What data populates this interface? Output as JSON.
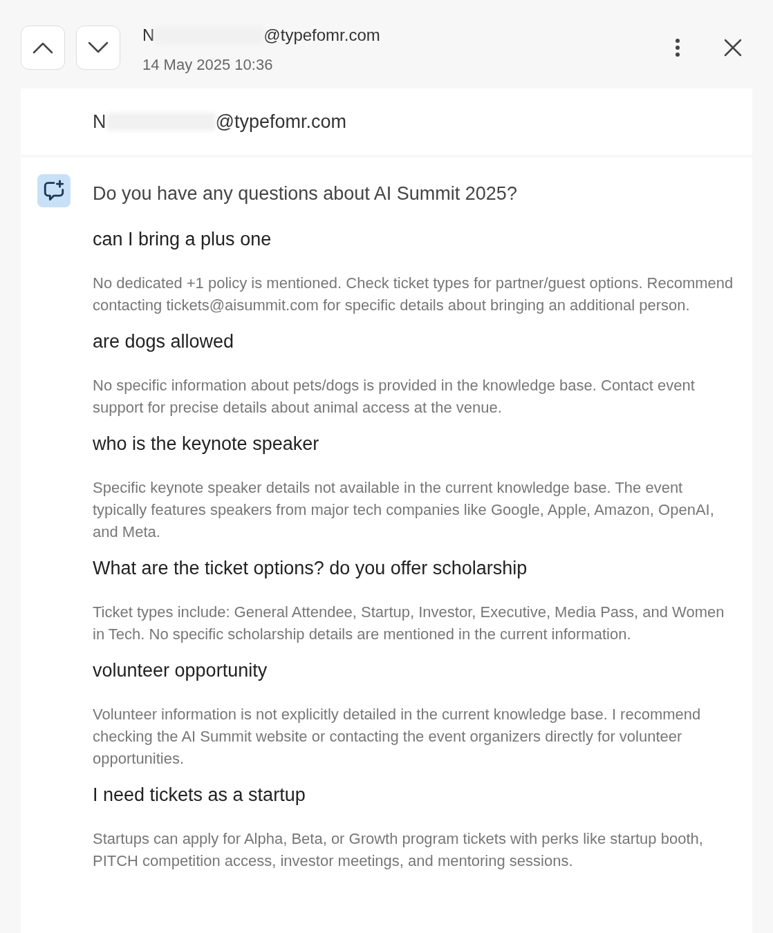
{
  "header": {
    "sender": {
      "start": "N",
      "domain": "@typefomr.com"
    },
    "date": "14 May 2025 10:36"
  },
  "recipient": {
    "start": "N",
    "domain": "@typefomr.com"
  },
  "intro": "Do you have any questions about AI Summit 2025?",
  "qa": [
    {
      "question": "can I bring a plus one",
      "answer": "No dedicated +1 policy is mentioned. Check ticket types for partner/guest options. Recommend contacting tickets@aisummit.com for specific details about bringing an additional person."
    },
    {
      "question": "are dogs allowed",
      "answer": "No specific information about pets/dogs is provided in the knowledge base. Contact event support for precise details about animal access at the venue."
    },
    {
      "question": "who is the keynote speaker",
      "answer": "Specific keynote speaker details not available in the current knowledge base. The event typically features speakers from major tech companies like Google, Apple, Amazon, OpenAI, and Meta."
    },
    {
      "question": "What are the ticket options? do you offer scholarship",
      "answer": "Ticket types include: General Attendee, Startup, Investor, Executive, Media Pass, and Women in Tech. No specific scholarship details are mentioned in the current information."
    },
    {
      "question": "volunteer opportunity",
      "answer": "Volunteer information is not explicitly detailed in the current knowledge base. I recommend checking the AI Summit website or contacting the event organizers directly for volunteer opportunities."
    },
    {
      "question": "I need tickets as a startup",
      "answer": "Startups can apply for Alpha, Beta, or Growth program tickets with perks like startup booth, PITCH competition access, investor meetings, and mentoring sessions."
    }
  ]
}
